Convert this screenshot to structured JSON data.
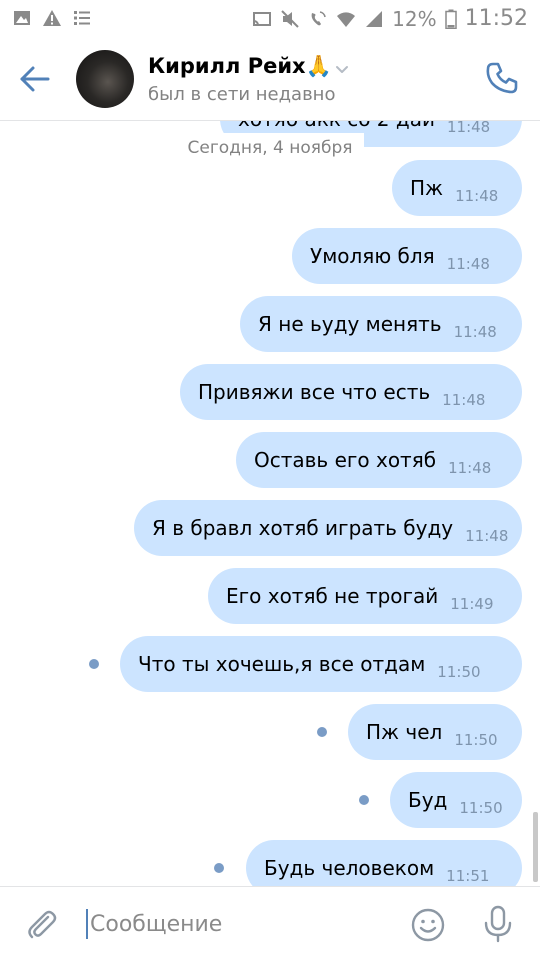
{
  "status_bar": {
    "battery_percent": "12%",
    "time": "11:52",
    "left_icons": [
      "image-icon",
      "warning-icon",
      "list-icon"
    ],
    "right_icons": [
      "cast-icon",
      "mute-icon",
      "wifi-call-icon",
      "wifi-icon",
      "signal-icon",
      "battery-icon"
    ]
  },
  "header": {
    "contact_name": "Кирилл Рейх🙏",
    "contact_status": "был в сети недавно",
    "icons": [
      "back-arrow-icon",
      "avatar",
      "chevron-down-icon",
      "phone-icon"
    ]
  },
  "chat": {
    "partial_message": "хотяб акк со 2 дай",
    "partial_time": "11:48",
    "date_separator": "Сегодня, 4 ноября",
    "messages": [
      {
        "text": "Пж",
        "time": "11:48",
        "unread": false
      },
      {
        "text": "Умоляю бля",
        "time": "11:48",
        "unread": false
      },
      {
        "text": "Я не ьуду менять",
        "time": "11:48",
        "unread": false
      },
      {
        "text": "Привяжи все что есть",
        "time": "11:48",
        "unread": false
      },
      {
        "text": "Оставь его хотяб",
        "time": "11:48",
        "unread": false
      },
      {
        "text": "Я в бравл хотяб играть буду",
        "time": "11:48",
        "unread": false
      },
      {
        "text": "Его хотяб не трогай",
        "time": "11:49",
        "unread": false
      },
      {
        "text": "Что ты хочешь,я все отдам",
        "time": "11:50",
        "unread": true
      },
      {
        "text": "Пж чел",
        "time": "11:50",
        "unread": true
      },
      {
        "text": "Буд",
        "time": "11:50",
        "unread": true
      },
      {
        "text": "Будь человеком",
        "time": "11:51",
        "unread": true
      }
    ]
  },
  "composer": {
    "placeholder": "Сообщение",
    "value": "",
    "icons": [
      "paperclip-icon",
      "emoji-icon",
      "microphone-icon"
    ]
  },
  "colors": {
    "accent": "#5181b8",
    "bubble": "#cce4ff",
    "time_text": "#7e94ad",
    "secondary_text": "#828282",
    "unread_dot": "#7a9cc6"
  }
}
